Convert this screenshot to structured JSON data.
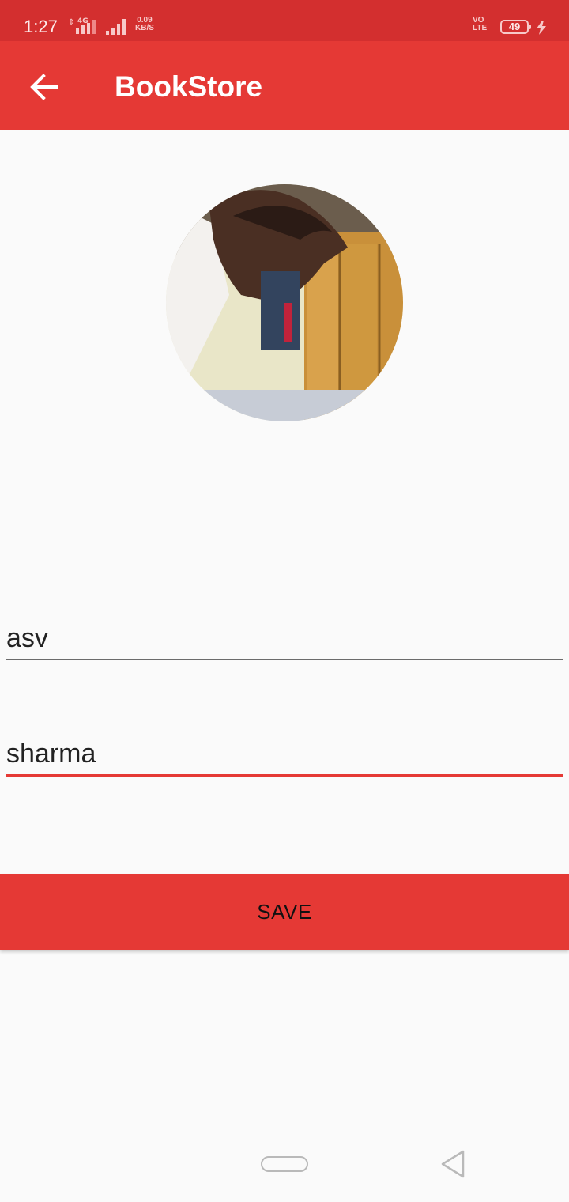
{
  "status_bar": {
    "time": "1:27",
    "network_type": "4G",
    "speed_value": "0.09",
    "speed_unit": "KB/S",
    "volte_top": "VO",
    "volte_bottom": "LTE",
    "battery_level": "49",
    "icons": [
      "signal-icon",
      "signal-icon",
      "volte-icon",
      "battery-icon",
      "charging-icon"
    ]
  },
  "app_bar": {
    "title": "BookStore",
    "back_icon": "arrow-left-icon"
  },
  "profile": {
    "avatar_icon": "profile-photo"
  },
  "form": {
    "first_name_value": "asv",
    "last_name_value": "sharma",
    "save_label": "SAVE"
  },
  "nav_bar": {
    "icons": [
      "home-pill-icon",
      "back-triangle-icon"
    ]
  },
  "colors": {
    "status_bar": "#d32f2f",
    "app_bar": "#e53935",
    "accent": "#e53935",
    "background": "#fafafa"
  }
}
